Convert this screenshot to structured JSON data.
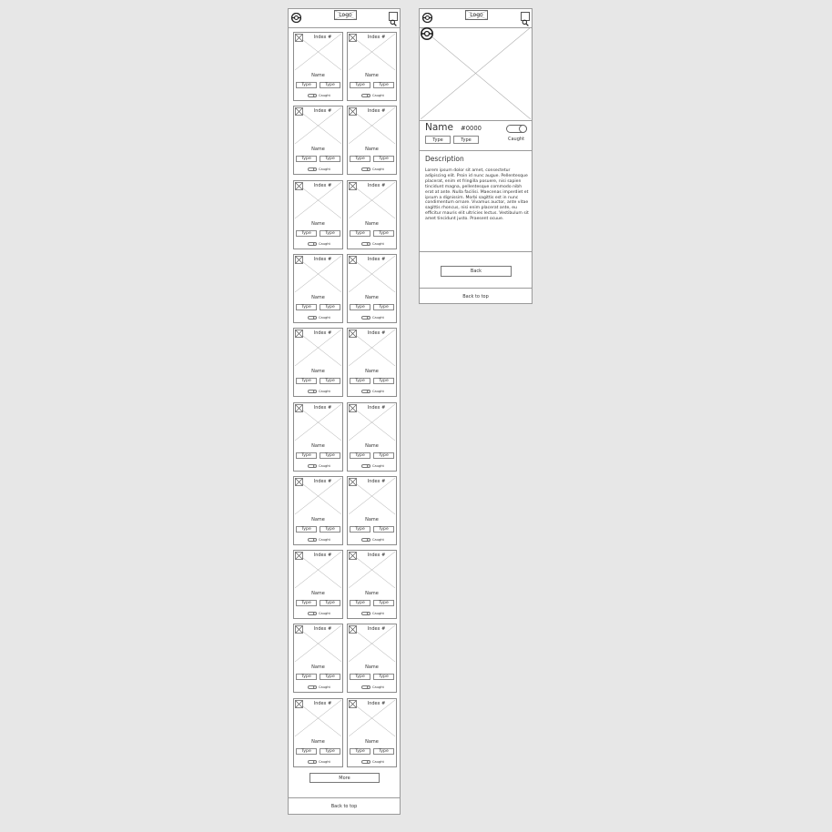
{
  "list_screen": {
    "header": {
      "logo_label": "Logo",
      "menu_icon": "pokeball-icon",
      "search_icon": "search-icon"
    },
    "cards": [
      {
        "index_label": "Index #",
        "name": "Name",
        "types": [
          "Type",
          "Type"
        ],
        "caught_label": "Caught"
      },
      {
        "index_label": "Index #",
        "name": "Name",
        "types": [
          "Type",
          "Type"
        ],
        "caught_label": "Caught"
      },
      {
        "index_label": "Index #",
        "name": "Name",
        "types": [
          "Type",
          "Type"
        ],
        "caught_label": "Caught"
      },
      {
        "index_label": "Index #",
        "name": "Name",
        "types": [
          "Type",
          "Type"
        ],
        "caught_label": "Caught"
      },
      {
        "index_label": "Index #",
        "name": "Name",
        "types": [
          "Type",
          "Type"
        ],
        "caught_label": "Caught"
      },
      {
        "index_label": "Index #",
        "name": "Name",
        "types": [
          "Type",
          "Type"
        ],
        "caught_label": "Caught"
      },
      {
        "index_label": "Index #",
        "name": "Name",
        "types": [
          "Type",
          "Type"
        ],
        "caught_label": "Caught"
      },
      {
        "index_label": "Index #",
        "name": "Name",
        "types": [
          "Type",
          "Type"
        ],
        "caught_label": "Caught"
      },
      {
        "index_label": "Index #",
        "name": "Name",
        "types": [
          "Type",
          "Type"
        ],
        "caught_label": "Caught"
      },
      {
        "index_label": "Index #",
        "name": "Name",
        "types": [
          "Type",
          "Type"
        ],
        "caught_label": "Caught"
      },
      {
        "index_label": "Index #",
        "name": "Name",
        "types": [
          "Type",
          "Type"
        ],
        "caught_label": "Caught"
      },
      {
        "index_label": "Index #",
        "name": "Name",
        "types": [
          "Type",
          "Type"
        ],
        "caught_label": "Caught"
      },
      {
        "index_label": "Index #",
        "name": "Name",
        "types": [
          "Type",
          "Type"
        ],
        "caught_label": "Caught"
      },
      {
        "index_label": "Index #",
        "name": "Name",
        "types": [
          "Type",
          "Type"
        ],
        "caught_label": "Caught"
      },
      {
        "index_label": "Index #",
        "name": "Name",
        "types": [
          "Type",
          "Type"
        ],
        "caught_label": "Caught"
      },
      {
        "index_label": "Index #",
        "name": "Name",
        "types": [
          "Type",
          "Type"
        ],
        "caught_label": "Caught"
      },
      {
        "index_label": "Index #",
        "name": "Name",
        "types": [
          "Type",
          "Type"
        ],
        "caught_label": "Caught"
      },
      {
        "index_label": "Index #",
        "name": "Name",
        "types": [
          "Type",
          "Type"
        ],
        "caught_label": "Caught"
      },
      {
        "index_label": "Index #",
        "name": "Name",
        "types": [
          "Type",
          "Type"
        ],
        "caught_label": "Caught"
      },
      {
        "index_label": "Index #",
        "name": "Name",
        "types": [
          "Type",
          "Type"
        ],
        "caught_label": "Caught"
      }
    ],
    "more_label": "More",
    "back_to_top_label": "Back to top"
  },
  "detail_screen": {
    "header": {
      "logo_label": "Logo",
      "menu_icon": "pokeball-icon",
      "search_icon": "search-icon"
    },
    "name": "Name",
    "number": "#0000",
    "types": [
      "Type",
      "Type"
    ],
    "caught_label": "Caught",
    "description_title": "Description",
    "description_text": "Lorem ipsum dolor sit amet, consectetur adipiscing elit. Proin id nunc augue. Pellentesque placerat, enim et fringilla posuere, nisi sapien tincidunt magna, pellentesque commodo nibh erat at ante. Nulla facilisi. Maecenas imperdiet et ipsum a dignissim. Morbi sagittis est in nunc condimentum ornare. Vivamus auctor, ante vitae sagittis rhoncus, nisi enim placerat ante, eu efficitur mauris elit ultricies lectus. Vestibulum sit amet tincidunt justo. Praesent ocuue.",
    "back_label": "Back",
    "back_to_top_label": "Back to top"
  },
  "colors": {
    "background": "#e7e7e7",
    "screen": "#ffffff",
    "line": "#9a9a9a"
  }
}
